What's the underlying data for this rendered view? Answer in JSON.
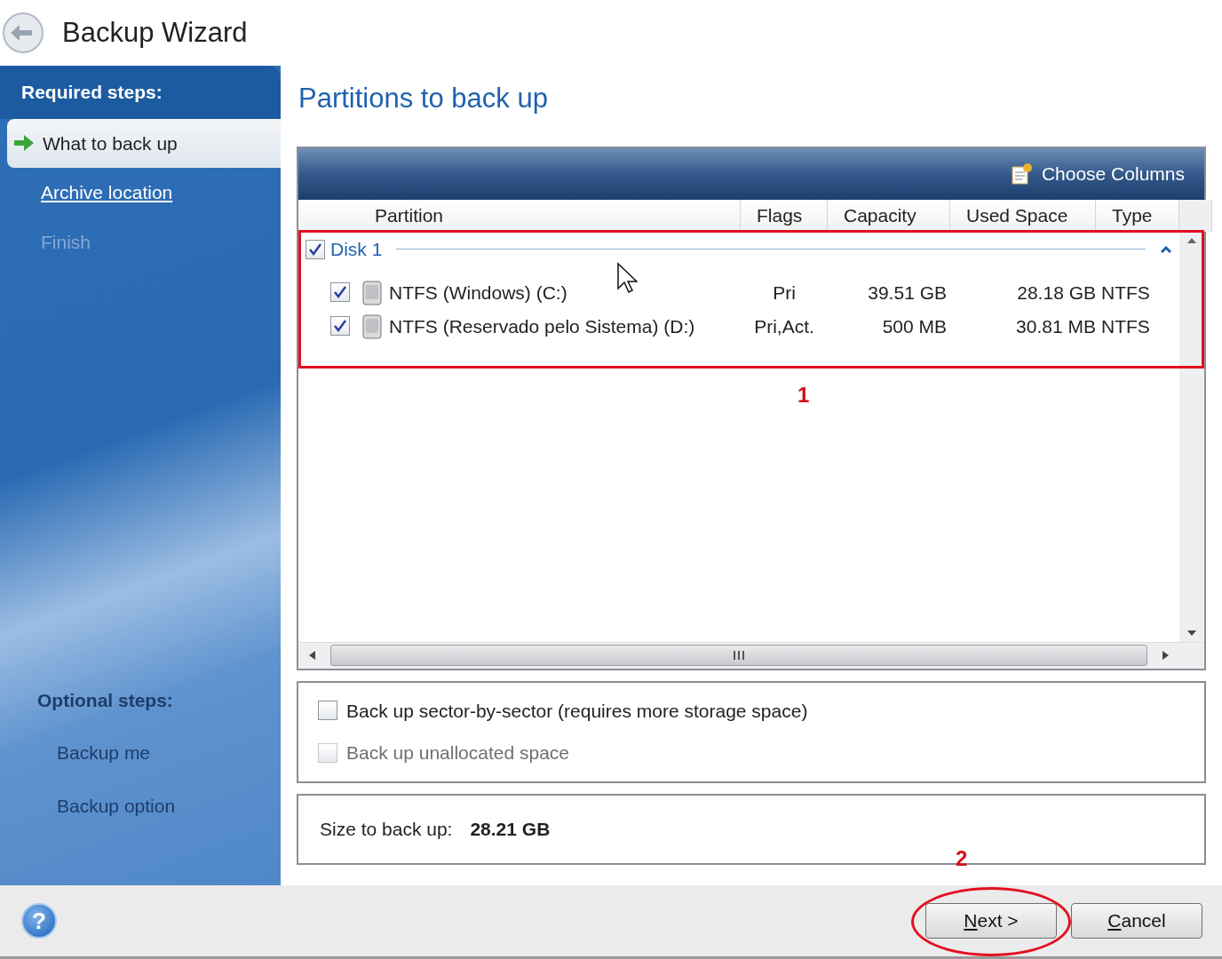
{
  "window": {
    "title": "Backup Wizard"
  },
  "sidebar": {
    "required_heading": "Required steps:",
    "required_steps": [
      {
        "label": "What to back up",
        "selected": true,
        "kind": "current"
      },
      {
        "label": "Archive location",
        "selected": false,
        "kind": "link"
      },
      {
        "label": "Finish",
        "selected": false,
        "kind": "disabled"
      }
    ],
    "optional_heading": "Optional steps:",
    "optional_steps": [
      {
        "label": "Backup me"
      },
      {
        "label": "Backup option"
      }
    ]
  },
  "page_title": "Partitions to back up",
  "table": {
    "toolbar_button": "Choose Columns",
    "columns": [
      "Partition",
      "Flags",
      "Capacity",
      "Used Space",
      "Type"
    ],
    "groups": [
      {
        "label": "Disk 1",
        "checked": true,
        "expanded": true,
        "rows": [
          {
            "checked": true,
            "partition": "NTFS (Windows) (C:)",
            "flags": "Pri",
            "capacity": "39.51 GB",
            "used_space": "28.18 GB",
            "type": "NTFS"
          },
          {
            "checked": true,
            "partition": "NTFS (Reservado pelo Sistema) (D:)",
            "flags": "Pri,Act.",
            "capacity": "500 MB",
            "used_space": "30.81 MB",
            "type": "NTFS"
          }
        ]
      }
    ]
  },
  "options": [
    {
      "label": "Back up sector-by-sector (requires more storage space)",
      "checked": false,
      "disabled": false
    },
    {
      "label": "Back up unallocated space",
      "checked": false,
      "disabled": true
    }
  ],
  "summary": {
    "label": "Size to back up:",
    "value": "28.21 GB"
  },
  "help_icon": "?",
  "buttons": [
    {
      "label": "Next >",
      "underline_first": true
    },
    {
      "label": "Cancel",
      "underline_first": true
    }
  ],
  "annotations": [
    {
      "label": "1",
      "kind": "rect"
    },
    {
      "label": "2",
      "kind": "ellipse"
    }
  ]
}
